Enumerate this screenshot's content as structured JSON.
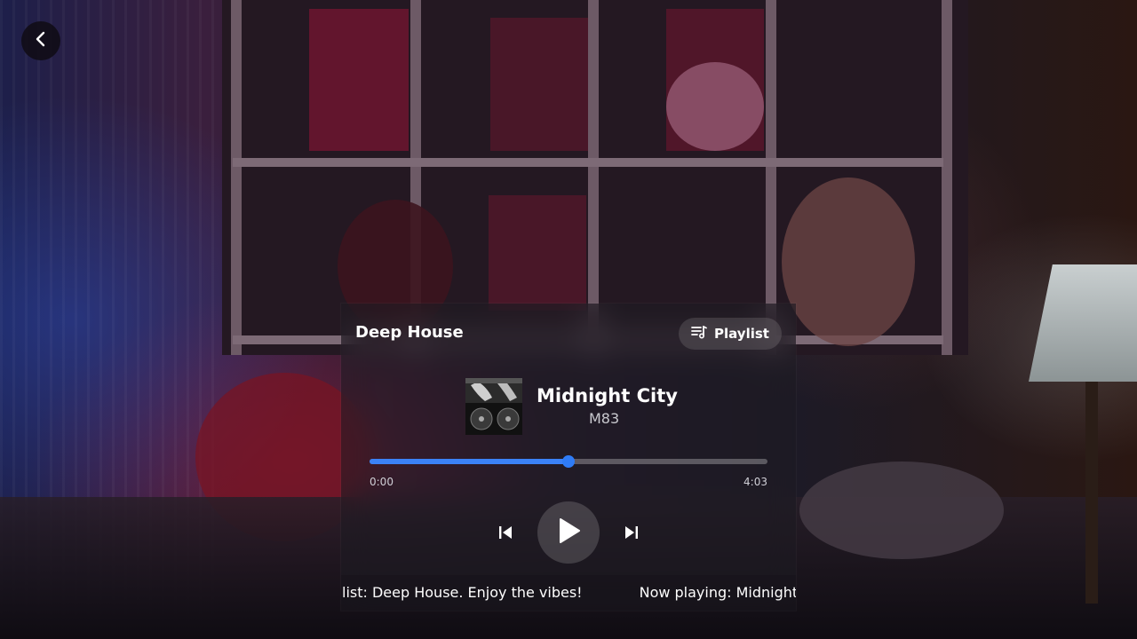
{
  "header": {
    "back_icon": "chevron-left-icon"
  },
  "player": {
    "playlist_name": "Deep House",
    "playlist_button": {
      "label": "Playlist",
      "icon": "playlist-icon"
    },
    "track": {
      "title": "Midnight City",
      "artist": "M83",
      "album_art": "turntable-artwork"
    },
    "progress": {
      "fraction": 0.5,
      "elapsed": "0:00",
      "duration": "4:03"
    },
    "controls": {
      "previous_icon": "skip-previous-icon",
      "play_icon": "play-icon",
      "next_icon": "skip-next-icon"
    },
    "ticker": {
      "segments": [
        "list: Deep House. Enjoy the vibes!",
        "Now playing: Midnight"
      ]
    }
  },
  "colors": {
    "accent": "#3b82f6",
    "panel": "#1e1c22"
  }
}
